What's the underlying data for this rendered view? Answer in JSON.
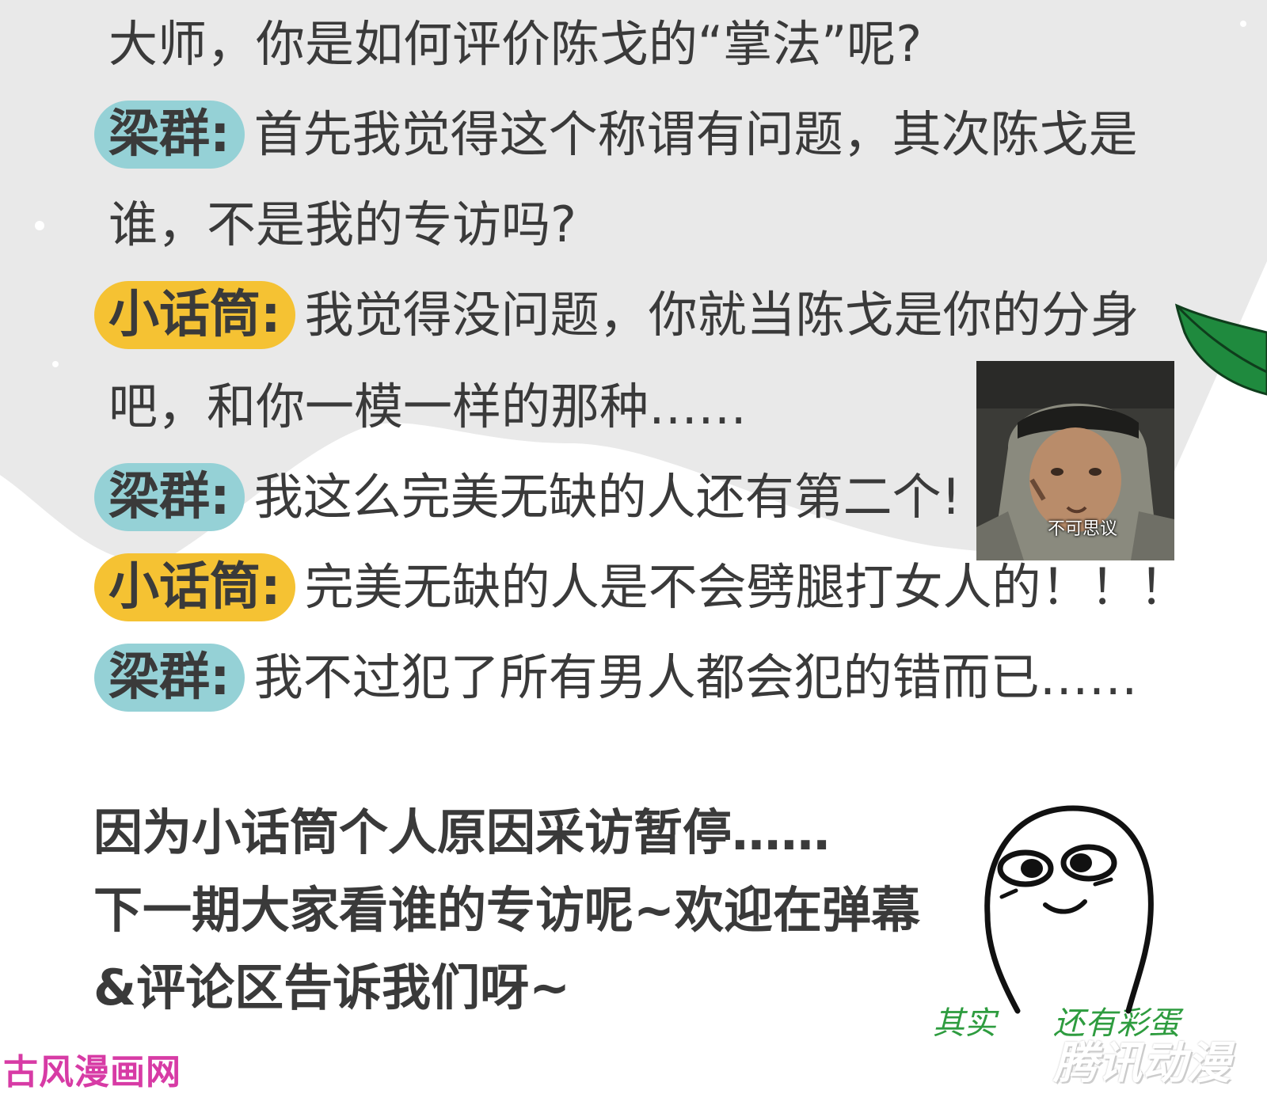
{
  "dialogue": {
    "question": "大师，你是如何评价陈戈的“掌法”呢?",
    "lines": [
      {
        "speaker": "梁群:",
        "text": "首先我觉得这个称谓有问题，其次陈戈是"
      },
      {
        "speaker": "",
        "text": "谁，不是我的专访吗?"
      },
      {
        "speaker": "小话筒:",
        "text": "我觉得没问题，你就当陈戈是你的分身"
      },
      {
        "speaker": "",
        "text": "吧，和你一模一样的那种……"
      },
      {
        "speaker": "梁群:",
        "text": "我这么完美无缺的人还有第二个!"
      },
      {
        "speaker": "小话筒:",
        "text": "完美无缺的人是不会劈腿打女人的！！！"
      },
      {
        "speaker": "梁群:",
        "text": "我不过犯了所有男人都会犯的错而已……"
      }
    ]
  },
  "meme": {
    "caption": "不可思议"
  },
  "closing": {
    "line1": "因为小话筒个人原因采访暂停……",
    "line2": "下一期大家看谁的专访呢~欢迎在弹幕",
    "line3": "&评论区告诉我们呀~"
  },
  "sticker": {
    "caption_left": "其实",
    "caption_right": "还有彩蛋"
  },
  "watermarks": {
    "left": "古风漫画网",
    "right": "腾讯动漫"
  },
  "colors": {
    "liangqun_badge": "#95d1d6",
    "xiaohuatong_badge": "#f5c233",
    "background_wave": "#e9e9e9",
    "leaf": "#1f8a3e",
    "sticker_caption": "#2e9c3f",
    "watermark_left": "#d73ba5"
  },
  "icons": [
    "leaf-icon",
    "smiling-face-sticker",
    "meme-photo"
  ]
}
